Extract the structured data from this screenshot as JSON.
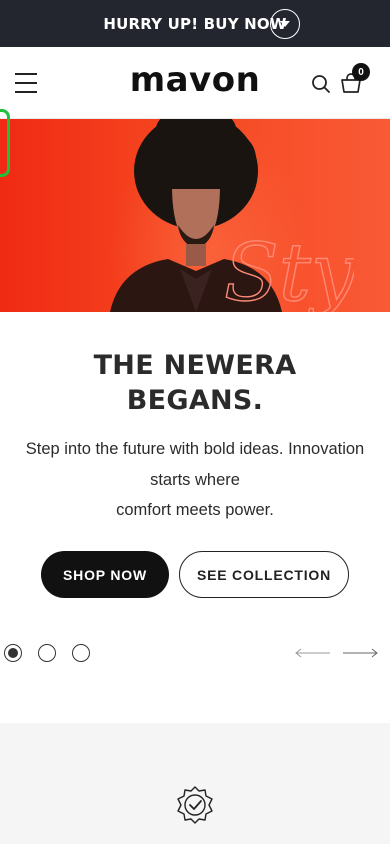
{
  "announcement": {
    "text": "HURRY UP! BUY NOW"
  },
  "header": {
    "logo": "mavon",
    "cart_count": "0"
  },
  "hero": {
    "image_script_word": "Style",
    "title_line1": "THE NEWERA",
    "title_line2": "BEGANS.",
    "desc_line1": "Step into the future with bold ideas. Innovation",
    "desc_line2": "starts where",
    "desc_line3": "comfort meets power.",
    "primary_button": "SHOP NOW",
    "secondary_button": "SEE COLLECTION"
  },
  "slider": {
    "slide_count": 3,
    "active_slide": 1
  },
  "colors": {
    "announcement_bg": "#23262f",
    "hero_bg": "#f23a1c",
    "accent_green": "#1fc13a",
    "primary_btn": "#111111",
    "section_bg": "#f5f5f5"
  },
  "icons": [
    "chevron-down-icon",
    "menu-icon",
    "search-icon",
    "cart-icon",
    "arrow-left-icon",
    "arrow-right-icon",
    "badge-check-icon"
  ]
}
